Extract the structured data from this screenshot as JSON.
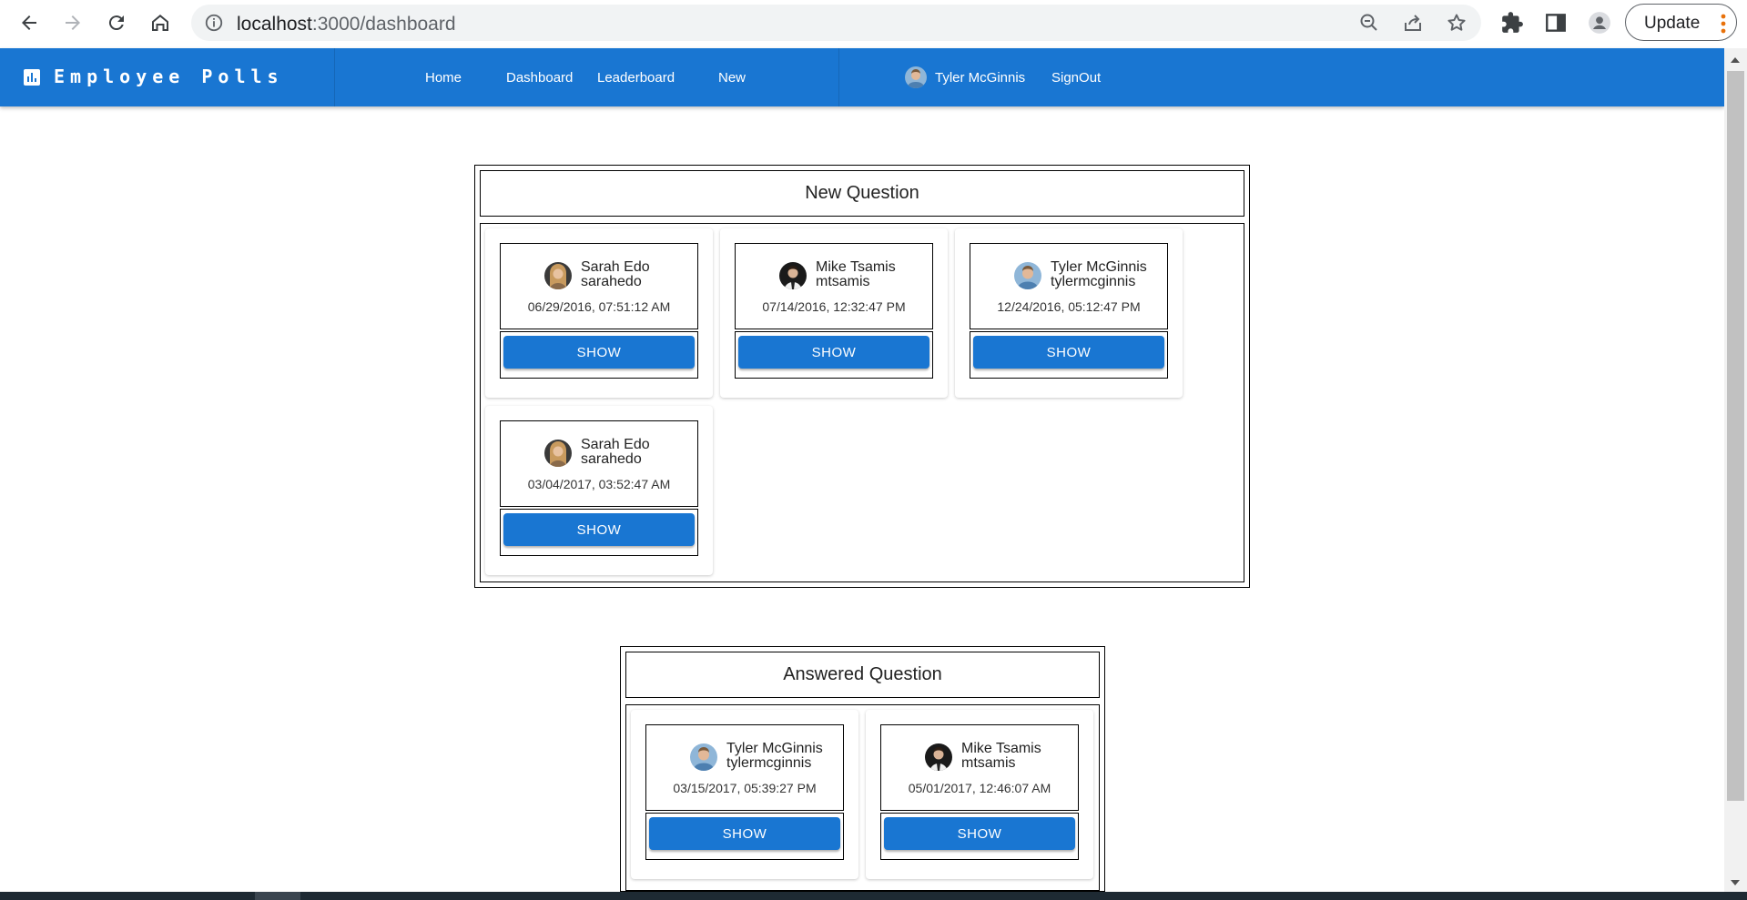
{
  "browser": {
    "url_host": "localhost",
    "url_rest": ":3000/dashboard",
    "update_label": "Update"
  },
  "appbar": {
    "brand": "Employee Polls",
    "links": {
      "home": "Home",
      "dashboard": "Dashboard",
      "leaderboard": "Leaderboard",
      "new": "New"
    },
    "user_name": "Tyler McGinnis",
    "signout": "SignOut"
  },
  "colors": {
    "primary": "#1976d2"
  },
  "new_questions": {
    "title": "New Question",
    "cards": [
      {
        "name": "Sarah Edo",
        "username": "sarahedo",
        "timestamp": "06/29/2016, 07:51:12 AM",
        "button": "SHOW"
      },
      {
        "name": "Mike Tsamis",
        "username": "mtsamis",
        "timestamp": "07/14/2016, 12:32:47 PM",
        "button": "SHOW"
      },
      {
        "name": "Tyler McGinnis",
        "username": "tylermcginnis",
        "timestamp": "12/24/2016, 05:12:47 PM",
        "button": "SHOW"
      },
      {
        "name": "Sarah Edo",
        "username": "sarahedo",
        "timestamp": "03/04/2017, 03:52:47 AM",
        "button": "SHOW"
      }
    ]
  },
  "answered_questions": {
    "title": "Answered Question",
    "cards": [
      {
        "name": "Tyler McGinnis",
        "username": "tylermcginnis",
        "timestamp": "03/15/2017, 05:39:27 PM",
        "button": "SHOW"
      },
      {
        "name": "Mike Tsamis",
        "username": "mtsamis",
        "timestamp": "05/01/2017, 12:46:07 AM",
        "button": "SHOW"
      }
    ]
  }
}
